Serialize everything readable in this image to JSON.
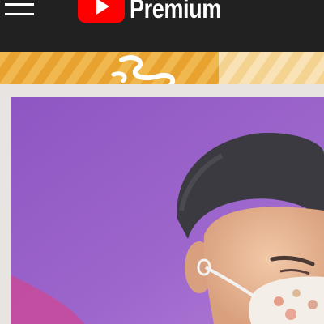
{
  "header": {
    "brand_text": "Premium",
    "menu_icon": "hamburger-menu-icon",
    "logo_icon": "youtube-play-logo-icon",
    "background_color": "#212121",
    "brand_red": "#ff0000"
  },
  "banner": {
    "pattern": "orange-diagonal-stripes",
    "colors": [
      "#e8a230",
      "#f6d79c",
      "#ffffff"
    ]
  },
  "thumbnail": {
    "background_color": "#9a62c8",
    "subject": "person-wearing-face-mask"
  }
}
